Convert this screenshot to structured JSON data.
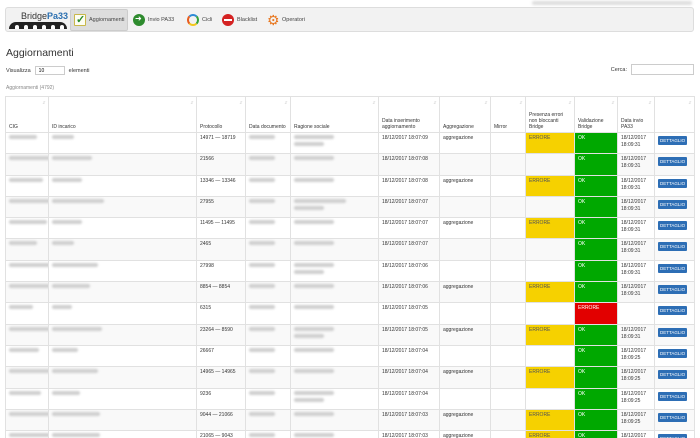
{
  "nav": {
    "logo": {
      "part1": "Bridge",
      "part2": "Pa33"
    },
    "items": [
      {
        "label": "Aggiornamenti",
        "icon": "check-icon",
        "active": true
      },
      {
        "label": "Invio PA33",
        "icon": "arrow-right-icon"
      },
      {
        "label": "Cicli",
        "icon": "cycle-icon"
      },
      {
        "label": "Blacklist",
        "icon": "ban-icon"
      },
      {
        "label": "Operatori",
        "icon": "gear-icon"
      }
    ]
  },
  "page": {
    "title": "Aggiornamenti",
    "show_prefix": "Visualizza",
    "show_value": "10",
    "show_suffix": "elementi",
    "search_label": "Cerca:",
    "caption": "Aggiornamenti (4792)"
  },
  "table": {
    "columns": [
      "CIG",
      "ID incarico",
      "Protocollo",
      "Data documento",
      "Ragione sociale",
      "Data inserimento aggiornamento",
      "Aggregazione",
      "Mirror",
      "Presenza errori non bloccanti Bridge",
      "Validazione Bridge",
      "Data invio PA33",
      ""
    ],
    "action_label": "DETTAGLIO",
    "rows": [
      {
        "protocollo": "14971 — 18719",
        "data_ins": "18/12/2017 18:07:09",
        "aggregazione": "aggregazione",
        "errori": "ERRORE",
        "validazione": "OK",
        "data_invio": "18/12/2017 18:09:31"
      },
      {
        "protocollo": "21566",
        "data_ins": "18/12/2017 18:07:08",
        "aggregazione": "",
        "errori": "",
        "validazione": "OK",
        "data_invio": "18/12/2017 18:09:31"
      },
      {
        "protocollo": "13346 — 13346",
        "data_ins": "18/12/2017 18:07:08",
        "aggregazione": "aggregazione",
        "errori": "ERRORE",
        "validazione": "OK",
        "data_invio": "18/12/2017 18:09:31"
      },
      {
        "protocollo": "27955",
        "data_ins": "18/12/2017 18:07:07",
        "aggregazione": "",
        "errori": "",
        "validazione": "OK",
        "data_invio": "18/12/2017 18:09:31"
      },
      {
        "protocollo": "11495 — 11495",
        "data_ins": "18/12/2017 18:07:07",
        "aggregazione": "aggregazione",
        "errori": "ERRORE",
        "validazione": "OK",
        "data_invio": "18/12/2017 18:09:31"
      },
      {
        "protocollo": "2465",
        "data_ins": "18/12/2017 18:07:07",
        "aggregazione": "",
        "errori": "",
        "validazione": "OK",
        "data_invio": "18/12/2017 18:09:31"
      },
      {
        "protocollo": "27998",
        "data_ins": "18/12/2017 18:07:06",
        "aggregazione": "",
        "errori": "",
        "validazione": "OK",
        "data_invio": "18/12/2017 18:09:31"
      },
      {
        "protocollo": "8854 — 8854",
        "data_ins": "18/12/2017 18:07:06",
        "aggregazione": "aggregazione",
        "errori": "ERRORE",
        "validazione": "OK",
        "data_invio": "18/12/2017 18:09:31"
      },
      {
        "protocollo": "6315",
        "data_ins": "18/12/2017 18:07:05",
        "aggregazione": "",
        "errori": "",
        "validazione": "ERRORE",
        "data_invio": ""
      },
      {
        "protocollo": "23264 — 8590",
        "data_ins": "18/12/2017 18:07:05",
        "aggregazione": "aggregazione",
        "errori": "ERRORE",
        "validazione": "OK",
        "data_invio": "18/12/2017 18:09:31"
      },
      {
        "protocollo": "26667",
        "data_ins": "18/12/2017 18:07:04",
        "aggregazione": "",
        "errori": "",
        "validazione": "OK",
        "data_invio": "18/12/2017 18:09:25"
      },
      {
        "protocollo": "14965 — 14965",
        "data_ins": "18/12/2017 18:07:04",
        "aggregazione": "aggregazione",
        "errori": "ERRORE",
        "validazione": "OK",
        "data_invio": "18/12/2017 18:09:25"
      },
      {
        "protocollo": "9236",
        "data_ins": "18/12/2017 18:07:04",
        "aggregazione": "",
        "errori": "",
        "validazione": "OK",
        "data_invio": "18/12/2017 18:09:25"
      },
      {
        "protocollo": "9044 — 21066",
        "data_ins": "18/12/2017 18:07:03",
        "aggregazione": "aggregazione",
        "errori": "ERRORE",
        "validazione": "OK",
        "data_invio": "18/12/2017 18:09:25"
      },
      {
        "protocollo": "21065 — 9043",
        "data_ins": "18/12/2017 18:07:03",
        "aggregazione": "aggregazione",
        "errori": "ERRORE",
        "validazione": "OK",
        "data_invio": "18/12/2017 18:09:25"
      }
    ]
  },
  "colors": {
    "error_yellow": "#f6d100",
    "ok_green": "#00a800",
    "error_red": "#e20000",
    "button_blue": "#2d6eb5"
  }
}
